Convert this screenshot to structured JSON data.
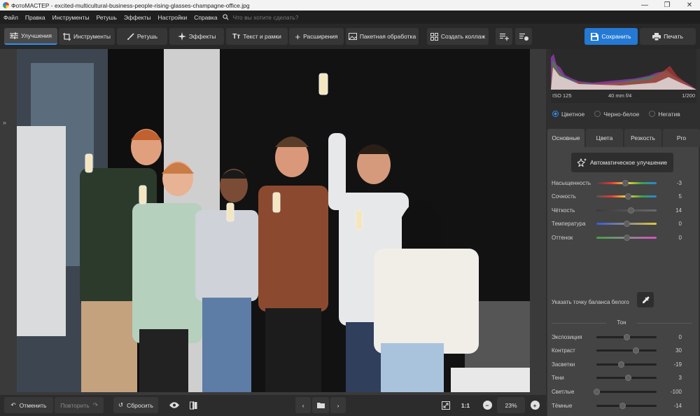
{
  "window": {
    "title": "ФотоМАСТЕР - excited-multicultural-business-people-rising-glasses-champagne-office.jpg"
  },
  "menu": {
    "items": [
      "Файл",
      "Правка",
      "Инструменты",
      "Ретушь",
      "Эффекты",
      "Настройки",
      "Справка"
    ],
    "search_placeholder": "Что вы хотите сделать?"
  },
  "toolbar": {
    "tabs": [
      {
        "label": "Улучшения",
        "icon": "sliders-icon"
      },
      {
        "label": "Инструменты",
        "icon": "crop-icon"
      },
      {
        "label": "Ретушь",
        "icon": "brush-icon"
      },
      {
        "label": "Эффекты",
        "icon": "sparkle-icon"
      },
      {
        "label": "Текст и рамки",
        "icon": "text-icon"
      },
      {
        "label": "Расширения",
        "icon": "plus-icon"
      },
      {
        "label": "Пакетная обработка",
        "icon": "image-stack-icon"
      },
      {
        "label": "Создать коллаж",
        "icon": "collage-icon"
      }
    ],
    "save_label": "Сохранить",
    "print_label": "Печать"
  },
  "histogram": {
    "iso": "ISO 125",
    "lens": "40 mm f/4",
    "shutter": "1/200"
  },
  "color_modes": {
    "options": [
      "Цветное",
      "Черно-белое",
      "Негатив"
    ],
    "selected": "Цветное"
  },
  "panel_tabs": {
    "items": [
      "Основные",
      "Цвета",
      "Резкость",
      "Pro"
    ],
    "active": "Основные"
  },
  "panel": {
    "auto_button": "Автоматическое улучшение",
    "color_sliders": [
      {
        "label": "Насыщенность",
        "value": "-3",
        "position": 0.48,
        "gradient": "linear-gradient(90deg,#444,#e53935,#fdd835,#43a047,#1e88e5)"
      },
      {
        "label": "Сочность",
        "value": "5",
        "position": 0.52,
        "gradient": "linear-gradient(90deg,#555,#e53935,#fdd835,#43a047,#1e88e5)"
      },
      {
        "label": "Чёткость",
        "value": "14",
        "position": 0.57,
        "gradient": "linear-gradient(90deg,#3a3a3a,#6a6a6a)"
      },
      {
        "label": "Температура",
        "value": "0",
        "position": 0.5,
        "gradient": "linear-gradient(90deg,#3a5bd9,#8a8a8a,#e0c83a)"
      },
      {
        "label": "Оттенок",
        "value": "0",
        "position": 0.5,
        "gradient": "linear-gradient(90deg,#43a047,#8a8a8a,#d84fc2)"
      }
    ],
    "white_balance_label": "Указать точку баланса белого",
    "tone_title": "Тон",
    "tone_sliders": [
      {
        "label": "Экспозиция",
        "value": "0",
        "position": 0.5
      },
      {
        "label": "Контраст",
        "value": "30",
        "position": 0.65
      },
      {
        "label": "Засветки",
        "value": "-19",
        "position": 0.41
      },
      {
        "label": "Тени",
        "value": "3",
        "position": 0.52
      },
      {
        "label": "Светлые",
        "value": "-100",
        "position": 0.0
      },
      {
        "label": "Тёмные",
        "value": "-14",
        "position": 0.43
      }
    ]
  },
  "bottom": {
    "undo": "Отменить",
    "redo": "Повторить",
    "reset": "Сбросить",
    "one_to_one": "1:1",
    "zoom": "23%"
  },
  "colors": {
    "accent": "#2f8ef0",
    "save": "#2479d4"
  }
}
